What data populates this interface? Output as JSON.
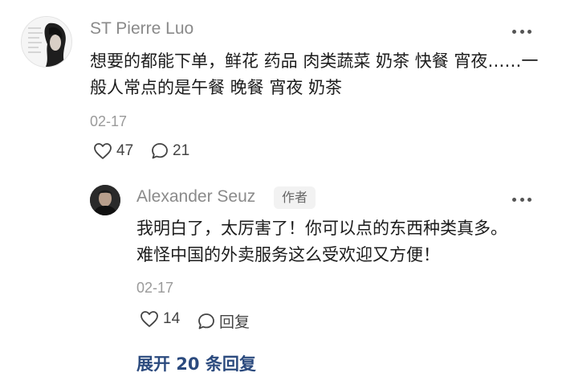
{
  "comment": {
    "author": "ST Pierre Luo",
    "text": "想要的都能下单，鲜花 药品 肉类蔬菜 奶茶 快餐 宵夜……一般人常点的是午餐 晚餐 宵夜 奶茶",
    "date": "02-17",
    "likes": "47",
    "comments": "21"
  },
  "reply": {
    "author": "Alexander Seuz",
    "author_tag": "作者",
    "text": "我明白了，太厉害了！你可以点的东西种类真多。难怪中国的外卖服务这么受欢迎又方便！",
    "date": "02-17",
    "likes": "14",
    "reply_label": "回复"
  },
  "expand_label": "展开 20 条回复",
  "icons": {
    "more": "more-dots-icon",
    "like": "heart-outline-icon",
    "comment": "comment-bubble-icon"
  }
}
